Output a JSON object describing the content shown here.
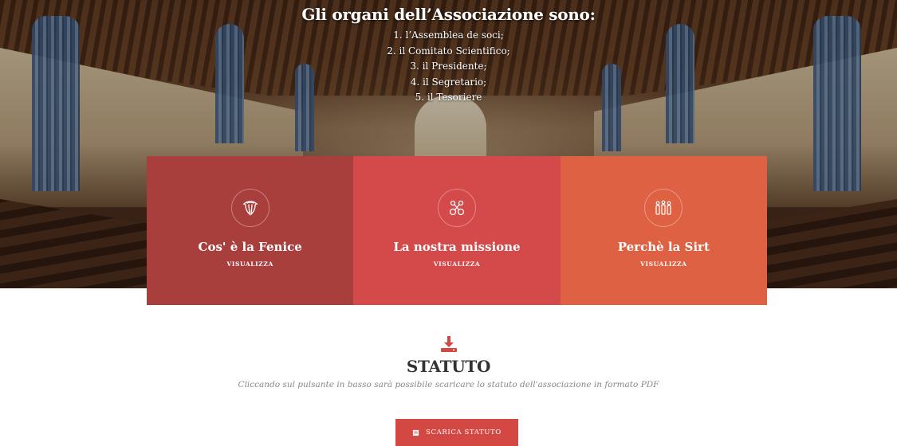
{
  "organs": {
    "title": "Gli organi dell’Associazione sono:",
    "items": [
      "1. l’Assemblea de soci;",
      "2. il Comitato Scientifico;",
      "3. il Presidente;",
      "4. il Segretario;",
      "5. il Tesoriere"
    ]
  },
  "features": [
    {
      "title": "Cos' è la Fenice",
      "link": "VISUALIZZA",
      "icon": "wings-icon",
      "color": "#a83f3d"
    },
    {
      "title": "La nostra missione",
      "link": "VISUALIZZA",
      "icon": "scissors-icon",
      "color": "#d4494a"
    },
    {
      "title": "Perchè la Sirt",
      "link": "VISUALIZZA",
      "icon": "people-icon",
      "color": "#de6143"
    }
  ],
  "statuto": {
    "title": "STATUTO",
    "description": "Cliccando sul pulsante in basso sarà possibile scaricare lo statuto dell'associazione in formato PDF",
    "button_label": "SCARICA STATUTO",
    "icon": "download-icon",
    "accent": "#d44843"
  }
}
